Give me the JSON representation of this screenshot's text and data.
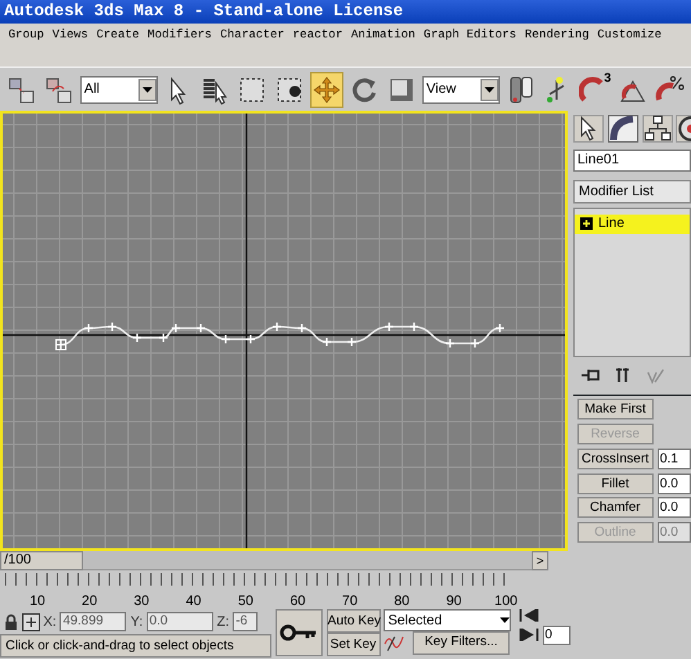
{
  "window": {
    "title": "Autodesk 3ds Max 8  - Stand-alone License"
  },
  "menu": [
    "Group",
    "Views",
    "Create",
    "Modifiers",
    "Character",
    "reactor",
    "Animation",
    "Graph Editors",
    "Rendering",
    "Customize"
  ],
  "toolbar": [
    {
      "kind": "link",
      "selected": false
    },
    {
      "kind": "unlink",
      "selected": false
    },
    {
      "kind": "dropdown",
      "value": "All"
    },
    {
      "kind": "select",
      "selected": false
    },
    {
      "kind": "select-by-name",
      "selected": false
    },
    {
      "kind": "region",
      "selected": false
    },
    {
      "kind": "crossing",
      "selected": false
    },
    {
      "kind": "move",
      "selected": true
    },
    {
      "kind": "rotate",
      "selected": false
    },
    {
      "kind": "scale",
      "selected": false
    },
    {
      "kind": "dropdown",
      "value": "View"
    },
    {
      "kind": "pivot",
      "selected": false
    },
    {
      "kind": "manipulate",
      "selected": false
    },
    {
      "kind": "snap",
      "selected": false,
      "badge": "3"
    },
    {
      "kind": "angle-snap",
      "selected": false
    },
    {
      "kind": "percent-snap",
      "selected": false
    }
  ],
  "command_panel": {
    "tabs": [
      {
        "kind": "create",
        "selected": false
      },
      {
        "kind": "modify",
        "selected": true
      },
      {
        "kind": "hierarchy",
        "selected": false
      },
      {
        "kind": "motion",
        "selected": false
      }
    ],
    "object_name": "Line01",
    "modifier_list": "Modifier List",
    "stack": [
      {
        "label": "Line",
        "selected": true,
        "expanded": false
      }
    ],
    "stack_tools": [
      {
        "kind": "pin",
        "disabled": false
      },
      {
        "kind": "show-result",
        "disabled": false
      },
      {
        "kind": "make-unique",
        "disabled": true
      }
    ],
    "geometry": [
      {
        "label": "Make First",
        "disabled": false
      },
      {
        "label": "Reverse",
        "disabled": true
      },
      {
        "label": "CrossInsert",
        "disabled": false,
        "value": "0.1"
      },
      {
        "label": "Fillet",
        "disabled": false,
        "value": "0.0"
      },
      {
        "label": "Chamfer",
        "disabled": false,
        "value": "0.0"
      },
      {
        "label": "Outline",
        "disabled": true,
        "value": "0.0"
      }
    ]
  },
  "timeline": {
    "frame": "/100",
    "next": ">",
    "level": 0
  },
  "ruler": [
    "10",
    "20",
    "30",
    "40",
    "50",
    "60",
    "70",
    "80",
    "90",
    "100"
  ],
  "coordinates": [
    {
      "label": "X:",
      "value": "49.899"
    },
    {
      "label": "Y:",
      "value": "0.0"
    },
    {
      "label": "Z:",
      "value": "-6"
    }
  ],
  "status": "Click or click-and-drag to select objects",
  "animation": {
    "auto_key": "Auto Key",
    "set_key": "Set Key",
    "key_mode": "Selected",
    "key_filters": "Key Filters...",
    "frame": "0"
  }
}
